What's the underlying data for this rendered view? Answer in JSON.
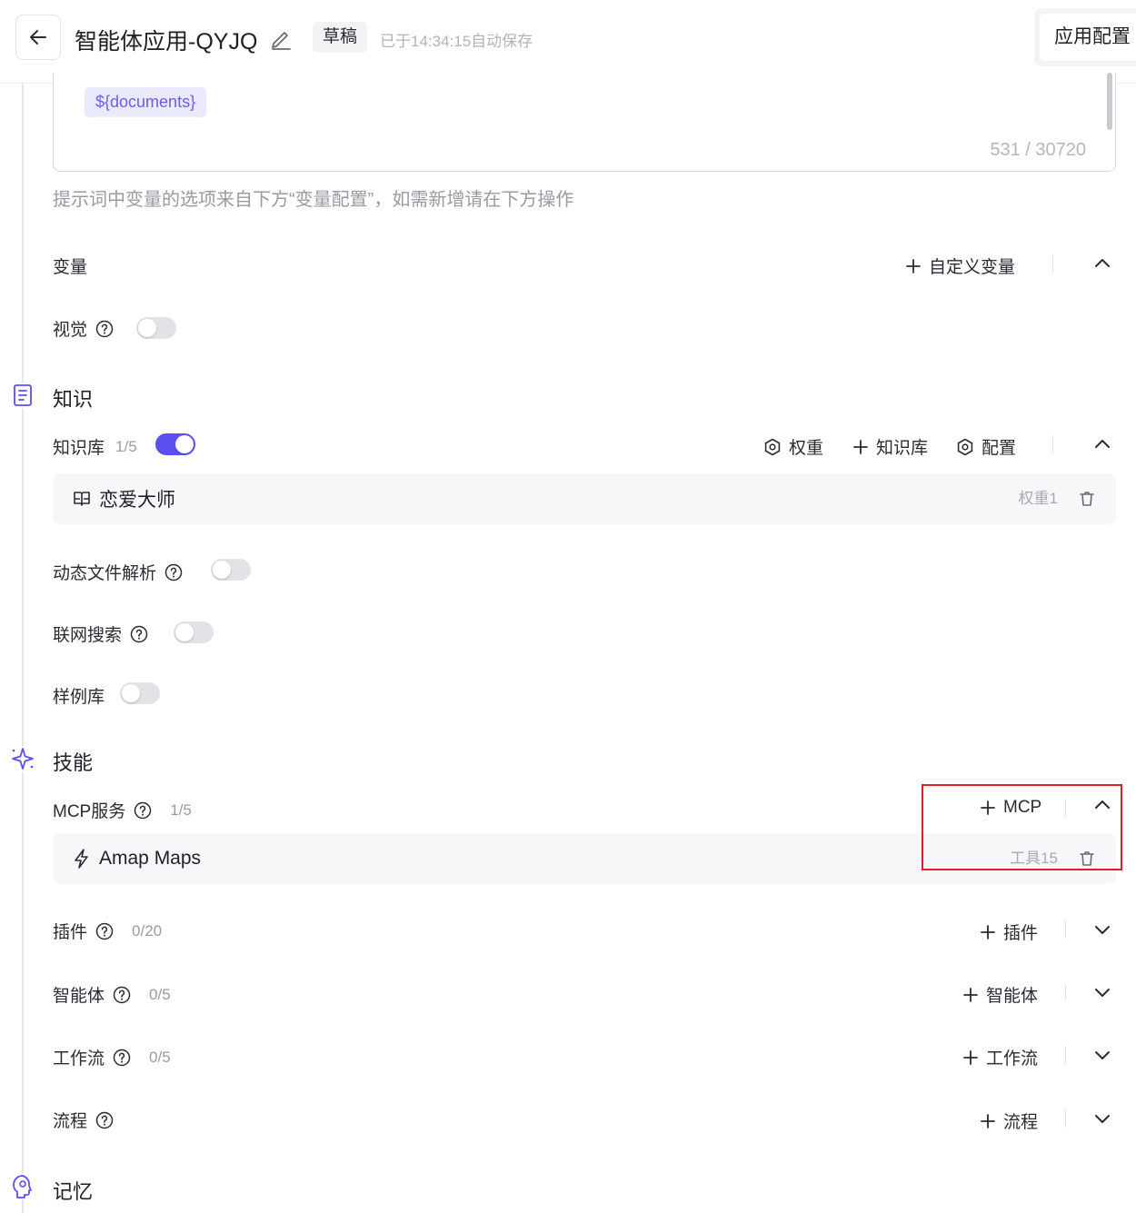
{
  "header": {
    "title": "智能体应用-QYJQ",
    "status_badge": "草稿",
    "autosave": "已于14:34:15自动保存",
    "config_button": "应用配置"
  },
  "prompt": {
    "variable_chip": "${documents}",
    "counter": "531 / 30720",
    "hint": "提示词中变量的选项来自下方“变量配置”，如需新增请在下方操作"
  },
  "variables": {
    "label": "变量",
    "add_action": "自定义变量"
  },
  "vision": {
    "label": "视觉",
    "enabled": false
  },
  "knowledge_section": {
    "title": "知识",
    "kb": {
      "label": "知识库",
      "count": "1/5",
      "enabled": true,
      "actions": [
        "权重",
        "知识库",
        "配置"
      ],
      "items": [
        {
          "name": "恋爱大师",
          "meta": "权重1"
        }
      ]
    },
    "dynamic_parse": {
      "label": "动态文件解析",
      "enabled": false
    },
    "web_search": {
      "label": "联网搜索",
      "enabled": false
    },
    "examples": {
      "label": "样例库",
      "enabled": false
    }
  },
  "skills_section": {
    "title": "技能",
    "mcp": {
      "label": "MCP服务",
      "count": "1/5",
      "add_action": "MCP",
      "items": [
        {
          "name": "Amap Maps",
          "meta": "工具15"
        }
      ]
    },
    "plugins": {
      "label": "插件",
      "count": "0/20",
      "add_action": "插件"
    },
    "agents": {
      "label": "智能体",
      "count": "0/5",
      "add_action": "智能体"
    },
    "workflows": {
      "label": "工作流",
      "count": "0/5",
      "add_action": "工作流"
    },
    "flows": {
      "label": "流程",
      "add_action": "流程"
    }
  },
  "memory_section": {
    "title": "记忆"
  },
  "colors": {
    "accent": "#5b4ff2",
    "highlight": "#e02020"
  }
}
